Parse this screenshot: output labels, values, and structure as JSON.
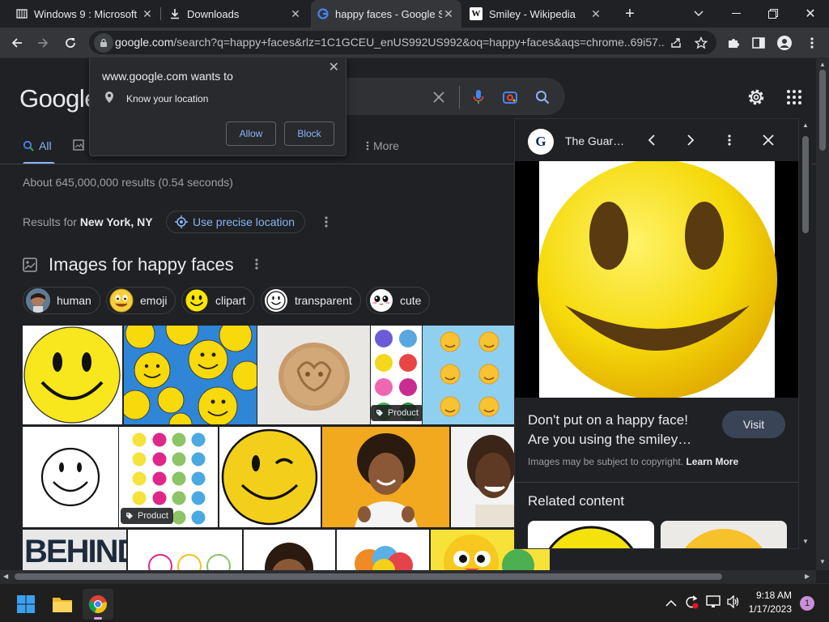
{
  "tabs": [
    {
      "title": "Windows 9 : Microsoft",
      "icon": "archive-icon",
      "active": false
    },
    {
      "title": "Downloads",
      "icon": "download-icon",
      "active": false
    },
    {
      "title": "happy faces - Google S",
      "icon": "google-icon",
      "active": true
    },
    {
      "title": "Smiley - Wikipedia",
      "icon": "wikipedia-icon",
      "active": false
    }
  ],
  "omnibox": {
    "host": "google.com",
    "path": "/search?q=happy+faces&rlz=1C1GCEU_enUS992US992&oq=happy+faces&aqs=chrome..69i57..."
  },
  "google": {
    "logo": "Google",
    "nav": {
      "all": "All",
      "more": "More"
    },
    "result_stats": "About 645,000,000 results (0.54 seconds)",
    "results_for_prefix": "Results for",
    "results_for_location": "New York, NY",
    "precise_location": "Use precise location",
    "images_header": "Images for happy faces",
    "chips": [
      "human",
      "emoji",
      "clipart",
      "transparent",
      "cute"
    ],
    "badges": {
      "product_1": "Product",
      "product_2": "Product"
    }
  },
  "permission_popup": {
    "title": "www.google.com wants to",
    "item": "Know your location",
    "allow": "Allow",
    "block": "Block"
  },
  "side_panel": {
    "source_name": "The Guar…",
    "source_icon_letter": "G",
    "title_line1": "Don't put on a happy face!",
    "title_line2": "Are you using the smiley…",
    "visit": "Visit",
    "copyright_prefix": "Images may be subject to copyright.",
    "learn_more": "Learn More",
    "related": "Related content"
  },
  "taskbar": {
    "time": "9:18 AM",
    "date": "1/17/2023",
    "notification_count": "1"
  },
  "colors": {
    "bg": "#202124",
    "link": "#8ab4f8",
    "smiley_yellow": "#f5d90a"
  }
}
